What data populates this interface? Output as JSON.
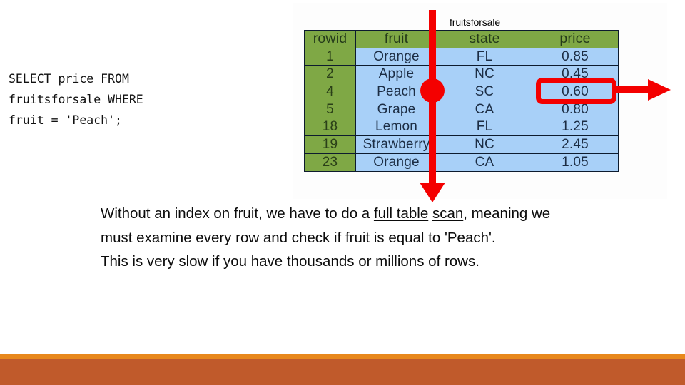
{
  "sql": {
    "query": "SELECT price FROM\nfruitsforsale WHERE\nfruit = 'Peach';"
  },
  "table_figure": {
    "caption": "fruitsforsale",
    "columns": [
      "rowid",
      "fruit",
      "state",
      "price"
    ],
    "rows": [
      {
        "rowid": "1",
        "fruit": "Orange",
        "state": "FL",
        "price": "0.85"
      },
      {
        "rowid": "2",
        "fruit": "Apple",
        "state": "NC",
        "price": "0.45"
      },
      {
        "rowid": "4",
        "fruit": "Peach",
        "state": "SC",
        "price": "0.60"
      },
      {
        "rowid": "5",
        "fruit": "Grape",
        "state": "CA",
        "price": "0.80"
      },
      {
        "rowid": "18",
        "fruit": "Lemon",
        "state": "FL",
        "price": "1.25"
      },
      {
        "rowid": "19",
        "fruit": "Strawberry",
        "state": "NC",
        "price": "2.45"
      },
      {
        "rowid": "23",
        "fruit": "Orange",
        "state": "CA",
        "price": "1.05"
      }
    ]
  },
  "annotations": {
    "accent_color": "#f40000",
    "scan_arrow_name": "full-table-scan-arrow",
    "marker_name": "current-row-marker",
    "highlight_name": "matched-price-highlight",
    "result_arrow_name": "result-output-arrow"
  },
  "explanation": {
    "line1_a": "Without an index on fruit, we have to do a ",
    "underline1": "full table",
    "underline2": "scan",
    "line2_b": ", meaning we must examine every row and check if fruit is equal to 'Peach'.",
    "line3": "This is very slow if you have thousands or millions of rows."
  },
  "decor": {
    "accent_orange": "#e8881c",
    "accent_brick": "#c05a2b"
  }
}
